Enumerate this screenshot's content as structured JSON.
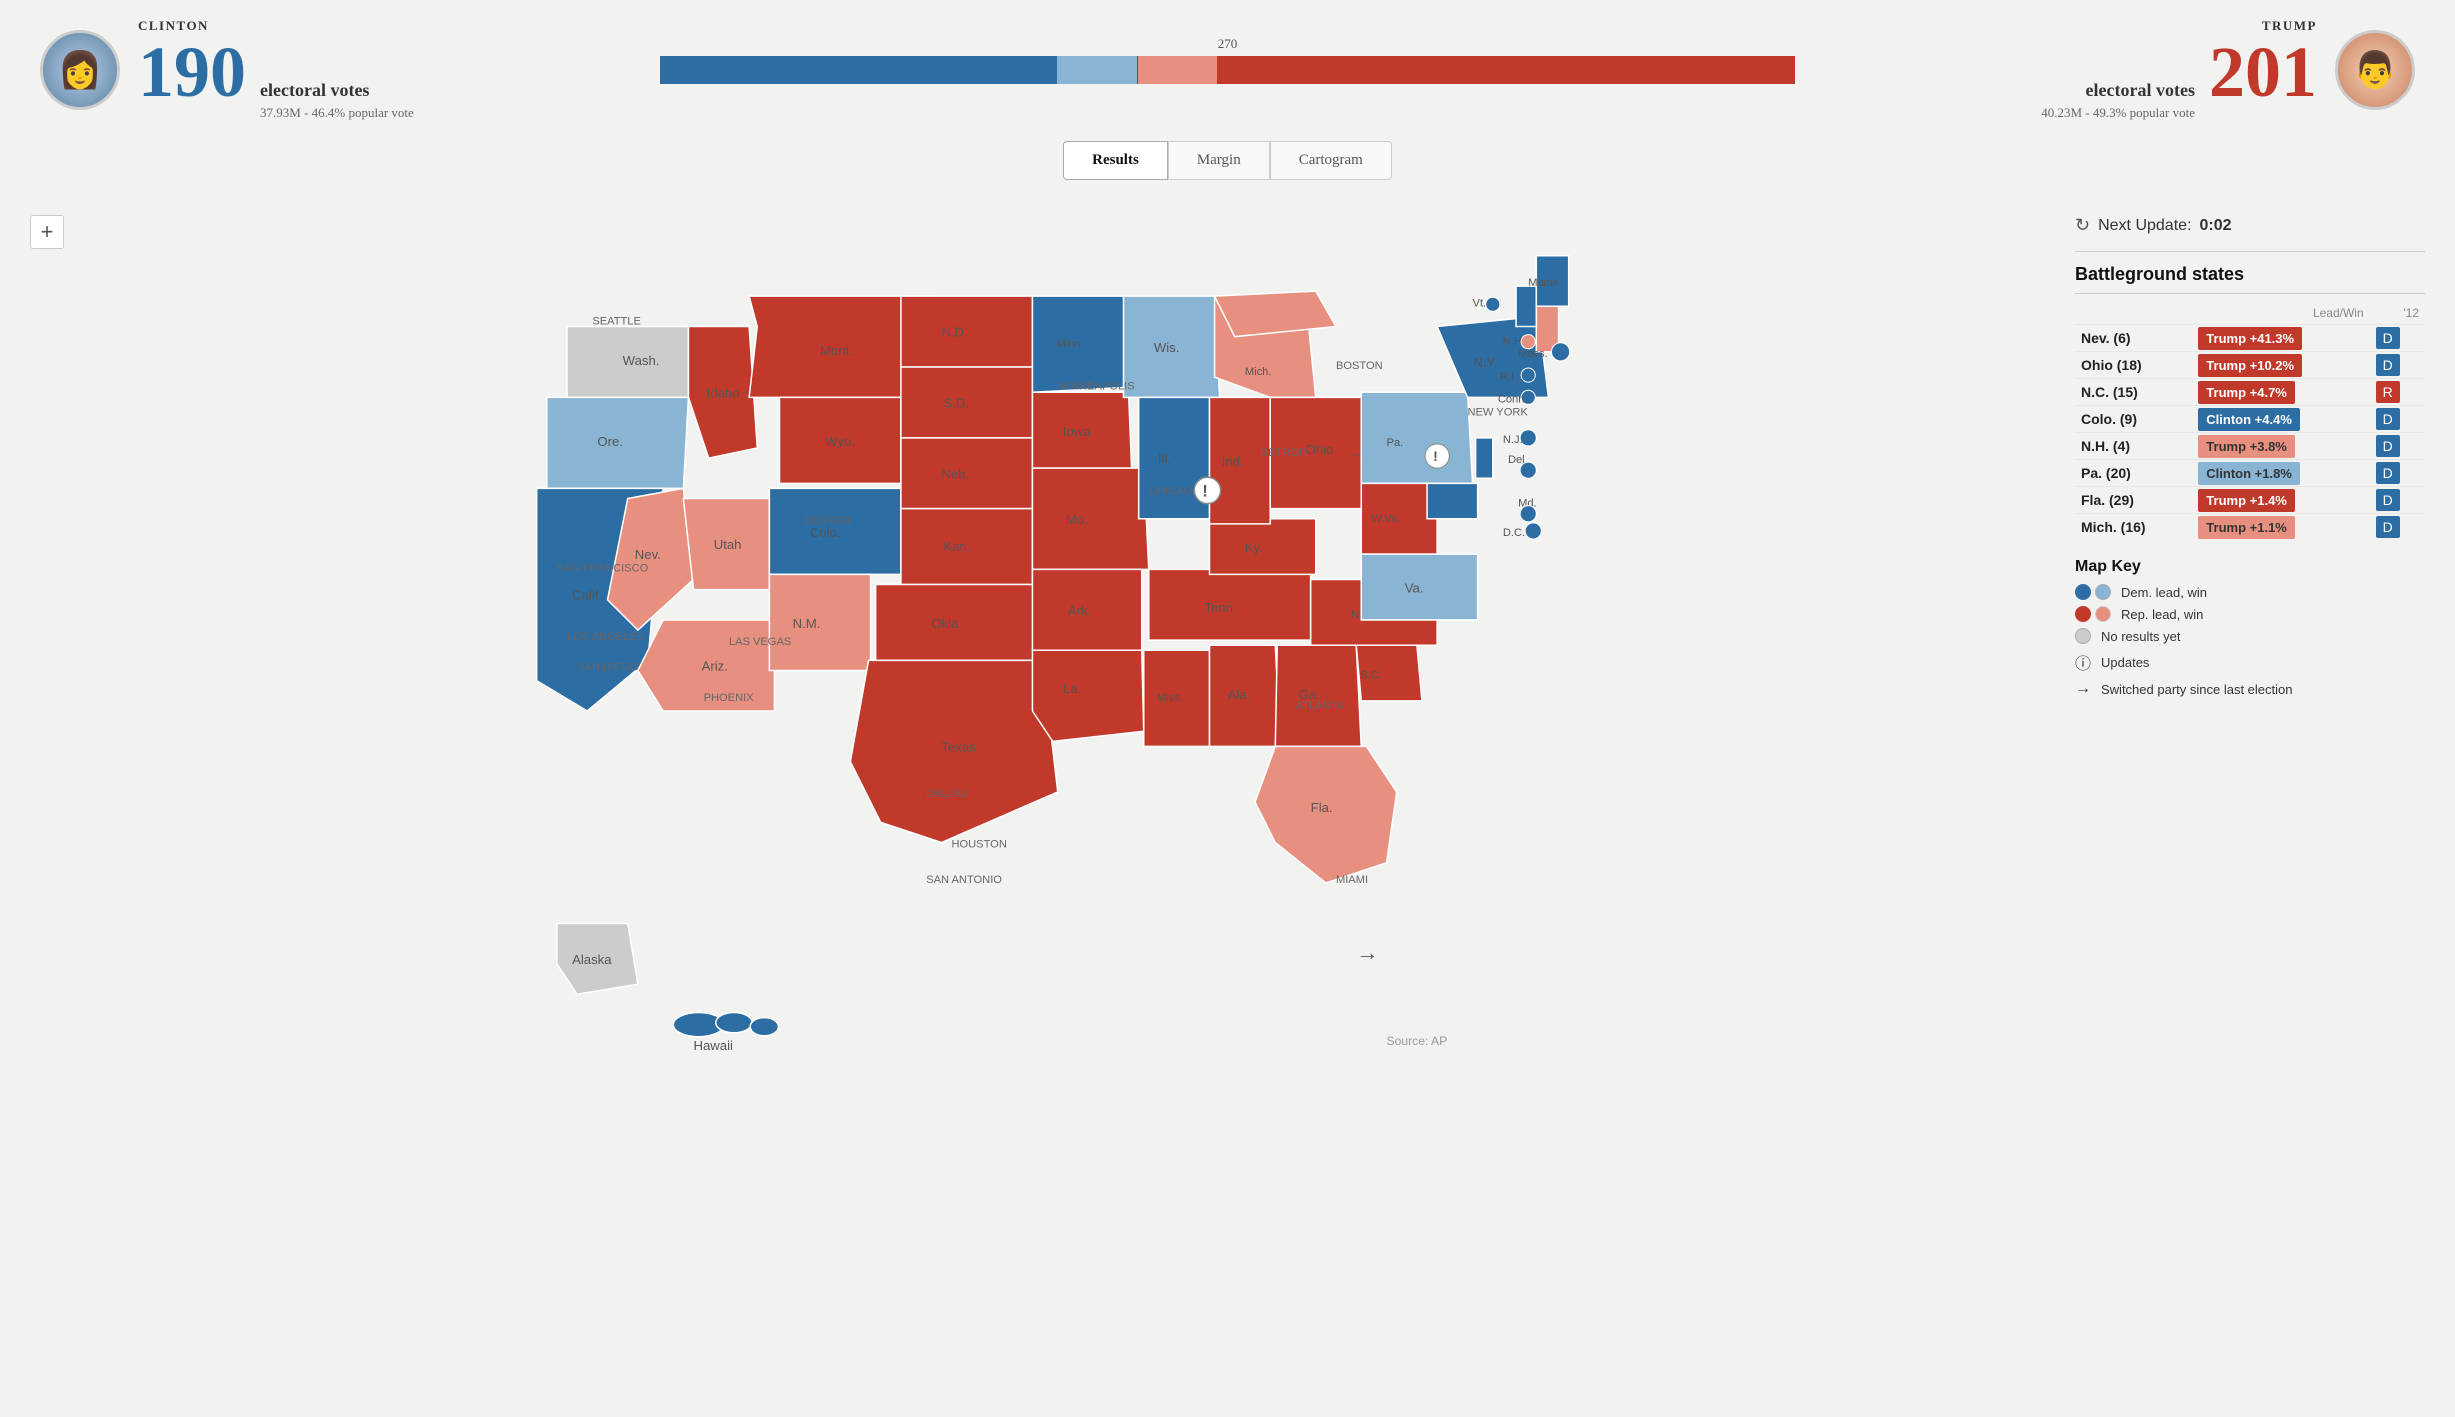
{
  "header": {
    "clinton": {
      "name": "CLINTON",
      "electoral_votes": "190",
      "vote_label": "electoral votes",
      "popular_vote": "37.93M - 46.4% popular vote",
      "color": "#2c6da4"
    },
    "trump": {
      "name": "TRUMP",
      "electoral_votes": "201",
      "vote_label": "electoral votes",
      "popular_vote": "40.23M - 49.3% popular vote",
      "color": "#c1392b"
    },
    "marker_270": "270"
  },
  "tabs": {
    "results": "Results",
    "margin": "Margin",
    "cartogram": "Cartogram",
    "active": "Results"
  },
  "sidebar": {
    "next_update_label": "Next Update:",
    "next_update_time": "0:02",
    "battleground_title": "Battleground states",
    "col_lead": "Lead/Win",
    "col_year": "'12",
    "states": [
      {
        "name": "Nev. (6)",
        "lead": "Trump +41.3%",
        "lead_type": "trump-win",
        "yr12": "D"
      },
      {
        "name": "Ohio (18)",
        "lead": "Trump +10.2%",
        "lead_type": "trump-win",
        "yr12": "D"
      },
      {
        "name": "N.C. (15)",
        "lead": "Trump +4.7%",
        "lead_type": "trump-win",
        "yr12": "R"
      },
      {
        "name": "Colo. (9)",
        "lead": "Clinton +4.4%",
        "lead_type": "clinton-win",
        "yr12": "D"
      },
      {
        "name": "N.H. (4)",
        "lead": "Trump +3.8%",
        "lead_type": "trump-lead",
        "yr12": "D"
      },
      {
        "name": "Pa. (20)",
        "lead": "Clinton +1.8%",
        "lead_type": "clinton-lead",
        "yr12": "D"
      },
      {
        "name": "Fla. (29)",
        "lead": "Trump +1.4%",
        "lead_type": "trump-win",
        "yr12": "D"
      },
      {
        "name": "Mich. (16)",
        "lead": "Trump +1.1%",
        "lead_type": "trump-lead",
        "yr12": "D"
      }
    ],
    "map_key_title": "Map Key",
    "map_key": [
      {
        "symbol": "dot-blue-dark",
        "label": "Dem. lead, win"
      },
      {
        "symbol": "dot-blue-light",
        "label": "Rep. lead, win"
      },
      {
        "symbol": "dot-red-dark",
        "label": "No results yet"
      },
      {
        "symbol": "dot-gray",
        "label": "Updates"
      },
      {
        "symbol": "arrow",
        "label": "Switched party since last election"
      }
    ]
  },
  "source": "Source: AP",
  "zoom_plus": "+"
}
